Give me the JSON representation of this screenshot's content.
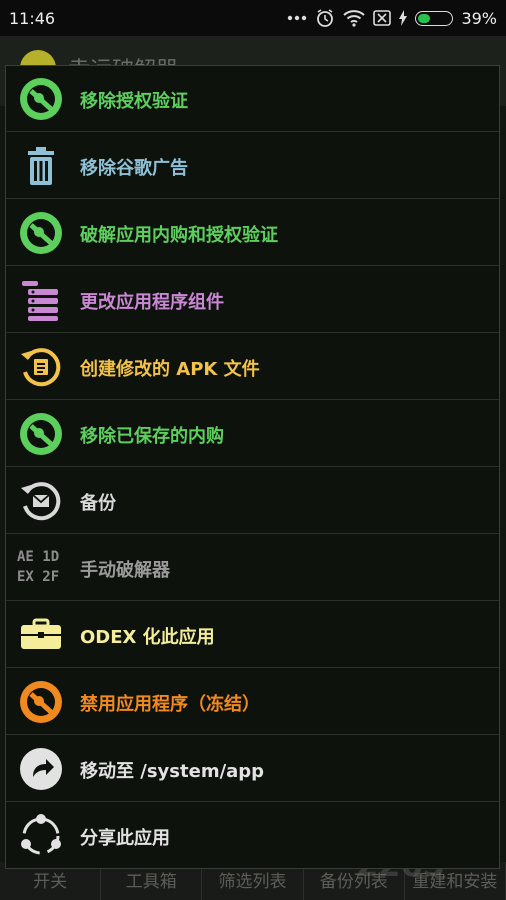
{
  "status_bar": {
    "time": "11:46",
    "battery_level": "39%",
    "battery_fraction": 0.39
  },
  "app_bar": {
    "title": "幸运破解器"
  },
  "menu": {
    "items": [
      {
        "label": "移除授权验证",
        "icon": "no-license-icon",
        "color": "#5ccf5c"
      },
      {
        "label": "移除谷歌广告",
        "icon": "trash-icon",
        "color": "#8ec0d6"
      },
      {
        "label": "破解应用内购和授权验证",
        "icon": "no-purchase-icon",
        "color": "#5ccf5c"
      },
      {
        "label": "更改应用程序组件",
        "icon": "components-icon",
        "color": "#c987d4"
      },
      {
        "label": "创建修改的 APK 文件",
        "icon": "apk-file-icon",
        "color": "#f2c24a"
      },
      {
        "label": "移除已保存的内购",
        "icon": "no-saved-purchase-icon",
        "color": "#5ccf5c"
      },
      {
        "label": "备份",
        "icon": "backup-icon",
        "color": "#d8d8d8"
      },
      {
        "label": "手动破解器",
        "icon": "hex-icon",
        "color": "#9a9a9a",
        "hex_lines": [
          "AE 1D",
          "EX 2F"
        ]
      },
      {
        "label": "ODEX 化此应用",
        "icon": "toolbox-icon",
        "color": "#f4ee9a"
      },
      {
        "label": "禁用应用程序（冻结）",
        "icon": "freeze-icon",
        "color": "#f08a1e"
      },
      {
        "label": "移动至 /system/app",
        "icon": "move-icon",
        "color": "#e2e2e2"
      },
      {
        "label": "分享此应用",
        "icon": "share-icon",
        "color": "#e2e2e2"
      }
    ]
  },
  "bottom_tabs": [
    "开关",
    "工具箱",
    "筛选列表",
    "备份列表",
    "重建和安装"
  ],
  "watermark": "2265"
}
